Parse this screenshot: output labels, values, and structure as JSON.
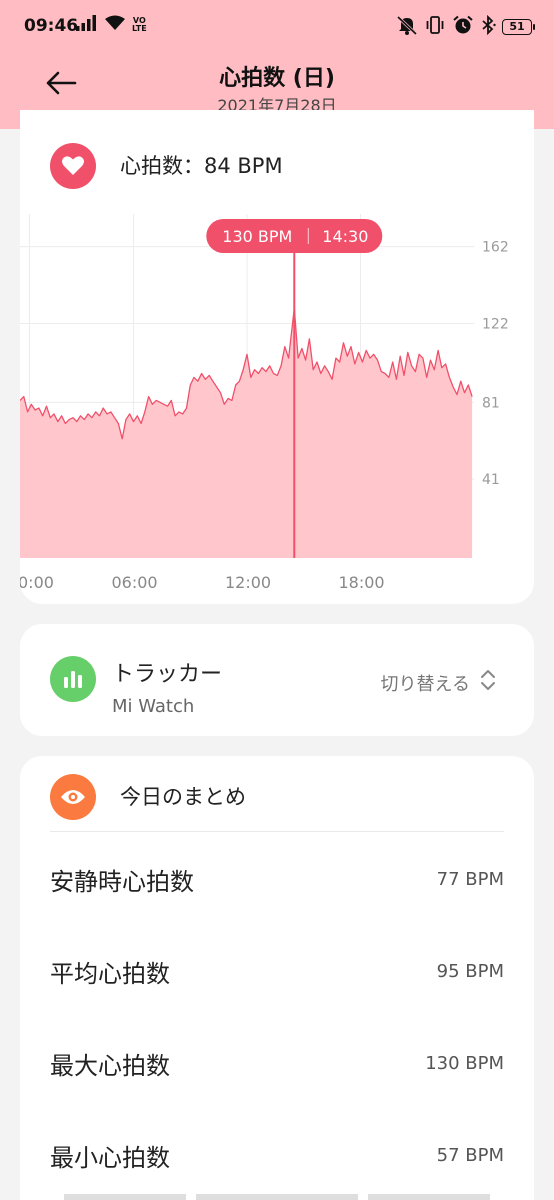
{
  "status": {
    "time": "09:46",
    "volte": "VO\nLTE",
    "battery": "51"
  },
  "header": {
    "title": "心拍数 (日)",
    "date": "2021年7月28日"
  },
  "heart_rate": {
    "label": "心拍数：84 BPM",
    "tooltip_value": "130 BPM",
    "tooltip_time": "14:30"
  },
  "chart_data": {
    "type": "area",
    "title": "",
    "xlabel": "",
    "ylabel": "",
    "x_ticks": [
      "0:00",
      "06:00",
      "12:00",
      "18:00"
    ],
    "y_ticks": [
      41,
      81,
      122,
      162
    ],
    "xlim_hours": [
      0,
      24
    ],
    "ylim": [
      0,
      179
    ],
    "color": "#f0506a",
    "fill_color": "#ffc6cc",
    "highlight": {
      "x": 14.5,
      "y": 130
    },
    "series": [
      {
        "x": [
          0.0,
          0.2,
          0.4,
          0.6,
          0.8,
          1.0,
          1.2,
          1.4,
          1.6,
          1.8,
          2.0,
          2.2,
          2.4,
          2.6,
          2.8,
          3.0,
          3.2,
          3.4,
          3.6,
          3.8,
          4.0,
          4.2,
          4.4,
          4.6,
          4.8,
          5.0,
          5.2,
          5.4,
          5.6,
          5.8,
          6.0,
          6.2,
          6.4,
          6.6,
          6.8,
          7.0,
          7.2,
          7.4,
          7.6,
          7.8,
          8.0,
          8.2,
          8.4,
          8.6,
          8.8,
          9.0,
          9.2,
          9.4,
          9.6,
          9.8,
          10.0,
          10.2,
          10.4,
          10.6,
          10.8,
          11.0,
          11.2,
          11.4,
          11.6,
          11.8,
          12.0,
          12.2,
          12.4,
          12.6,
          12.8,
          13.0,
          13.2,
          13.4,
          13.6,
          13.8,
          14.0,
          14.2,
          14.5,
          14.7,
          14.9,
          15.1,
          15.3,
          15.5,
          15.7,
          15.9,
          16.1,
          16.3,
          16.5,
          16.7,
          16.9,
          17.1,
          17.3,
          17.5,
          17.7,
          17.9,
          18.1,
          18.3,
          18.5,
          18.7,
          18.9,
          19.1,
          19.3,
          19.5,
          19.7,
          19.9,
          20.1,
          20.3,
          20.5,
          20.7,
          20.9,
          21.1,
          21.3,
          21.5,
          21.7,
          21.9,
          22.1,
          22.3,
          22.5,
          22.7,
          22.9,
          23.1,
          23.3,
          23.5,
          23.7,
          23.9
        ],
        "y": [
          82,
          84,
          76,
          80,
          77,
          78,
          74,
          79,
          73,
          75,
          71,
          74,
          70,
          72,
          73,
          71,
          74,
          72,
          75,
          73,
          76,
          74,
          78,
          75,
          76,
          73,
          70,
          62,
          72,
          75,
          71,
          74,
          70,
          76,
          84,
          80,
          82,
          81,
          80,
          79,
          82,
          74,
          76,
          75,
          78,
          90,
          94,
          92,
          96,
          93,
          95,
          92,
          89,
          86,
          80,
          83,
          82,
          90,
          92,
          98,
          106,
          94,
          98,
          96,
          99,
          97,
          100,
          96,
          95,
          100,
          110,
          104,
          130,
          104,
          109,
          103,
          114,
          98,
          102,
          96,
          100,
          97,
          93,
          104,
          102,
          112,
          105,
          110,
          101,
          107,
          102,
          108,
          104,
          106,
          103,
          97,
          96,
          94,
          102,
          93,
          105,
          95,
          107,
          100,
          97,
          106,
          104,
          94,
          103,
          98,
          108,
          99,
          101,
          94,
          89,
          85,
          92,
          86,
          90,
          84
        ]
      }
    ]
  },
  "tracker": {
    "title": "トラッカー",
    "device": "Mi Watch",
    "switch_label": "切り替える"
  },
  "summary": {
    "title": "今日のまとめ",
    "rows": [
      {
        "label": "安静時心拍数",
        "value": "77 BPM"
      },
      {
        "label": "平均心拍数",
        "value": "95 BPM"
      },
      {
        "label": "最大心拍数",
        "value": "130 BPM"
      },
      {
        "label": "最小心拍数",
        "value": "57 BPM"
      }
    ]
  }
}
